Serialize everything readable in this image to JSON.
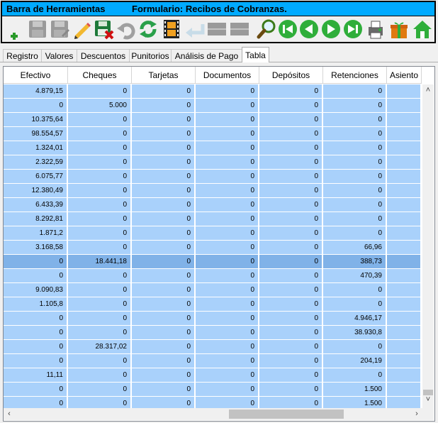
{
  "toolbar": {
    "title_left": "Barra de Herramientas",
    "title_right": "Formulario: Recibos de Cobranzas.",
    "icons": [
      "add-icon",
      "save-disabled-icon",
      "save-as-disabled-icon",
      "edit-icon",
      "save-delete-icon",
      "undo-disabled-icon",
      "refresh-icon",
      "film-icon",
      "back-enter-icon",
      "disabled-grid-icon",
      "disabled-grid-icon-2",
      "search-icon",
      "first-record-icon",
      "previous-record-icon",
      "next-record-icon",
      "last-record-icon",
      "print-icon",
      "gift-icon",
      "home-icon"
    ]
  },
  "tabs": [
    "Registro",
    "Valores",
    "Descuentos",
    "Punitorios",
    "Análisis de Pago",
    "Tabla"
  ],
  "active_tab": "Tabla",
  "table": {
    "headers": [
      "Efectivo",
      "Cheques",
      "Tarjetas",
      "Documentos",
      "Depósitos",
      "Retenciones",
      "Asiento"
    ],
    "selected_row": 12,
    "rows": [
      [
        "4.879,15",
        "0",
        "0",
        "0",
        "0",
        "0",
        ""
      ],
      [
        "0",
        "5.000",
        "0",
        "0",
        "0",
        "0",
        ""
      ],
      [
        "10.375,64",
        "0",
        "0",
        "0",
        "0",
        "0",
        ""
      ],
      [
        "98.554,57",
        "0",
        "0",
        "0",
        "0",
        "0",
        ""
      ],
      [
        "1.324,01",
        "0",
        "0",
        "0",
        "0",
        "0",
        ""
      ],
      [
        "2.322,59",
        "0",
        "0",
        "0",
        "0",
        "0",
        ""
      ],
      [
        "6.075,77",
        "0",
        "0",
        "0",
        "0",
        "0",
        ""
      ],
      [
        "12.380,49",
        "0",
        "0",
        "0",
        "0",
        "0",
        ""
      ],
      [
        "6.433,39",
        "0",
        "0",
        "0",
        "0",
        "0",
        ""
      ],
      [
        "8.292,81",
        "0",
        "0",
        "0",
        "0",
        "0",
        ""
      ],
      [
        "1.871,2",
        "0",
        "0",
        "0",
        "0",
        "0",
        ""
      ],
      [
        "3.168,58",
        "0",
        "0",
        "0",
        "0",
        "66,96",
        ""
      ],
      [
        "0",
        "18.441,18",
        "0",
        "0",
        "0",
        "388,73",
        ""
      ],
      [
        "0",
        "0",
        "0",
        "0",
        "0",
        "470,39",
        ""
      ],
      [
        "9.090,83",
        "0",
        "0",
        "0",
        "0",
        "0",
        ""
      ],
      [
        "1.105,8",
        "0",
        "0",
        "0",
        "0",
        "0",
        ""
      ],
      [
        "0",
        "0",
        "0",
        "0",
        "0",
        "4.946,17",
        ""
      ],
      [
        "0",
        "0",
        "0",
        "0",
        "0",
        "38.930,8",
        ""
      ],
      [
        "0",
        "28.317,02",
        "0",
        "0",
        "0",
        "0",
        ""
      ],
      [
        "0",
        "0",
        "0",
        "0",
        "0",
        "204,19",
        ""
      ],
      [
        "11,11",
        "0",
        "0",
        "0",
        "0",
        "0",
        ""
      ],
      [
        "0",
        "0",
        "0",
        "0",
        "0",
        "1.500",
        ""
      ],
      [
        "0",
        "0",
        "0",
        "0",
        "0",
        "1.500",
        ""
      ]
    ]
  },
  "colors": {
    "title_bar": "#00aaff",
    "cell_bg": "#a9d1fb",
    "selected_bg": "#80b2e8"
  }
}
